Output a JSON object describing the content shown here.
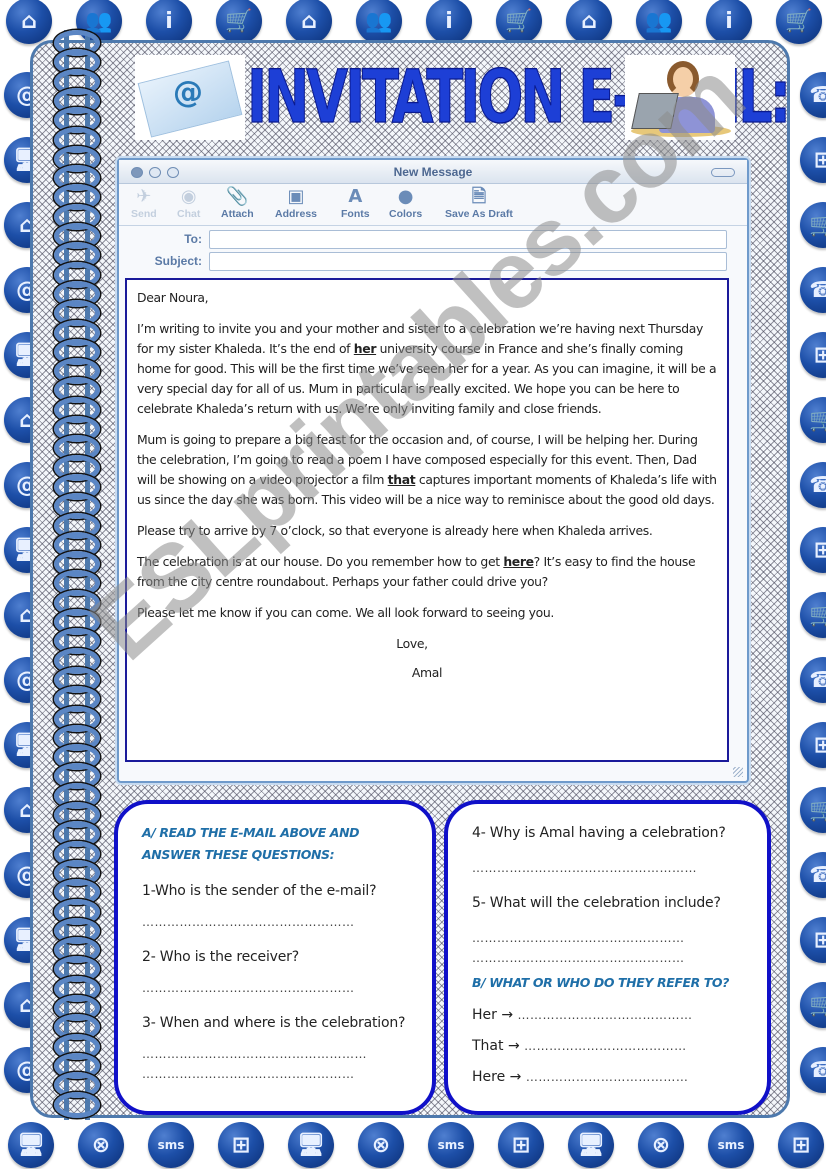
{
  "border_icons": {
    "top": [
      "home",
      "users",
      "info",
      "cart",
      "home",
      "users",
      "info",
      "cart",
      "home",
      "users",
      "info",
      "cart"
    ],
    "bottom": [
      "computer",
      "globe",
      "sms",
      "network",
      "computer",
      "globe",
      "sms",
      "network",
      "computer",
      "globe",
      "sms",
      "network"
    ],
    "left": [
      "at",
      "computer",
      "home",
      "at",
      "computer",
      "home",
      "at",
      "computer",
      "home",
      "at",
      "computer",
      "home",
      "at",
      "computer",
      "home",
      "at"
    ],
    "right": [
      "phone",
      "network",
      "cart",
      "phone",
      "network",
      "cart",
      "phone",
      "network",
      "cart",
      "phone",
      "network",
      "cart",
      "phone",
      "network",
      "cart",
      "phone"
    ],
    "glyphs": {
      "home": "⌂",
      "users": "👥",
      "info": "i",
      "cart": "🛒",
      "computer": "🖥",
      "globe": "⊗",
      "sms": "sms",
      "network": "⊞",
      "at": "@",
      "phone": "☎"
    },
    "sms_label": "sms"
  },
  "header": {
    "title": "INVITATION E-MAIL:",
    "at_symbol": "@"
  },
  "mail_window": {
    "title": "New Message",
    "toolbar": [
      {
        "label": "Send",
        "icon": "send-icon",
        "glyph": "✈",
        "enabled": false
      },
      {
        "label": "Chat",
        "icon": "chat-icon",
        "glyph": "◉",
        "enabled": false
      },
      {
        "label": "Attach",
        "icon": "paperclip-icon",
        "glyph": "📎",
        "enabled": true
      },
      {
        "label": "Address",
        "icon": "address-book-icon",
        "glyph": "▣",
        "enabled": true
      },
      {
        "label": "Fonts",
        "icon": "fonts-icon",
        "glyph": "A",
        "enabled": true
      },
      {
        "label": "Colors",
        "icon": "colors-icon",
        "glyph": "●",
        "enabled": true
      },
      {
        "label": "Save As Draft",
        "icon": "draft-icon",
        "glyph": "🗎",
        "enabled": true
      }
    ],
    "to_label": "To:",
    "to_value": "",
    "subject_label": "Subject:",
    "subject_value": ""
  },
  "email": {
    "greeting": "Dear Noura,",
    "p1_a": "I’m writing to invite you and your mother and sister to a celebration we’re having next Thursday for my sister Khaleda. It’s the end of ",
    "p1_ref": "her",
    "p1_b": " university course in France and she’s finally coming home for good. This will be the first time we’ve seen her for a year. As you can imagine, it will be a very special day for all of us. Mum in particular is really excited. We hope you can be here to celebrate Khaleda’s return with us. We’re only inviting family and close friends.",
    "p2_a": "Mum is going to prepare a big feast for the occasion and, of course, I will be helping her. During the celebration, I’m going to read a poem I have composed especially for this event. Then, Dad will be showing on a video projector a film ",
    "p2_ref": "that",
    "p2_b": " captures important moments of Khaleda’s life with us since the day she was born. This video will be a nice way to reminisce about the good old days.",
    "p3": "Please try to arrive by 7 o’clock, so that everyone is already here when Khaleda arrives.",
    "p4_a": "The celebration is at our house. Do you remember how to get ",
    "p4_ref": "here",
    "p4_b": "? It’s easy to find the house from the city centre roundabout. Perhaps your father could drive you?",
    "p5": "Please let me know if you can come. We all look forward to seeing you.",
    "closing": "Love,",
    "signature": "Amal"
  },
  "section_a": {
    "heading": "A/ READ THE E-MAIL ABOVE AND ANSWER THESE QUESTIONS:",
    "questions": [
      {
        "text": "1-Who is the sender of the e-mail?",
        "answer_line": "……………………………………………"
      },
      {
        "text": "2- Who is the receiver?",
        "answer_line": "……………………………………………"
      },
      {
        "text": "3- When and where is the celebration?",
        "answer_line": "………………………………………………",
        "answer_line_2": "……………………………………………"
      },
      {
        "text": "4- Why is Amal having a celebration?",
        "answer_line": "………………………………………………"
      },
      {
        "text": "5- What will the celebration include?",
        "answer_line": "……………………………………………",
        "answer_line_2": "……………………………………………"
      }
    ]
  },
  "section_b": {
    "heading": "B/ WHAT OR WHO DO THEY REFER TO?",
    "items": [
      {
        "word": "Her",
        "arrow": "→",
        "answer_line": "……………………………………"
      },
      {
        "word": "That",
        "arrow": "→",
        "answer_line": "…………………………………"
      },
      {
        "word": "Here",
        "arrow": "→",
        "answer_line": "…………………………………"
      }
    ]
  },
  "watermark": "ESLprintables.com"
}
